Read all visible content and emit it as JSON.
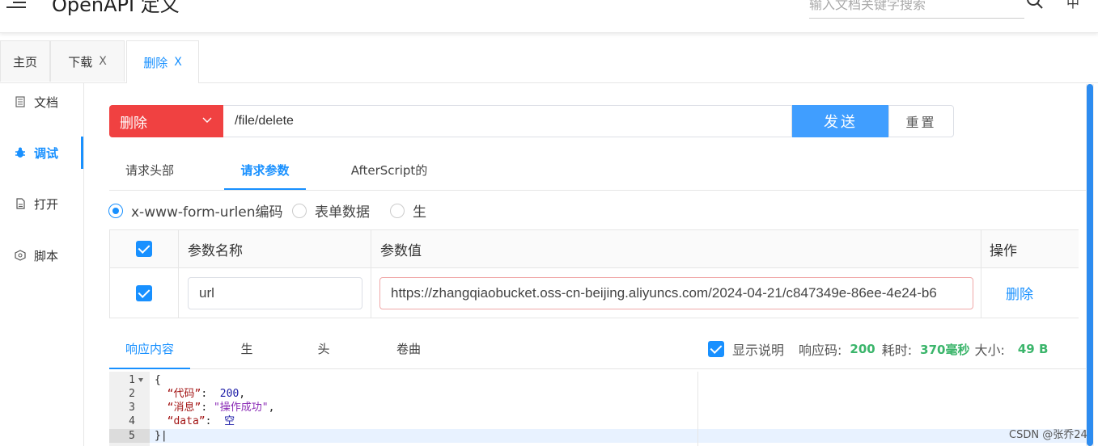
{
  "header": {
    "title": "OpenAPI 定义",
    "search_placeholder": "输入文档关键字搜索",
    "lang": "中"
  },
  "tabs": [
    {
      "label": "主页"
    },
    {
      "label": "下载",
      "close": "X"
    },
    {
      "label": "删除",
      "close": "X"
    }
  ],
  "sidebar": {
    "items": [
      {
        "label": "文档",
        "icon": "document-icon"
      },
      {
        "label": "调试",
        "icon": "bug-icon"
      },
      {
        "label": "打开",
        "icon": "file-icon"
      },
      {
        "label": "脚本",
        "icon": "script-icon"
      }
    ]
  },
  "request": {
    "method": "删除",
    "url": "/file/delete",
    "send_label": "发送",
    "reset_label": "重置"
  },
  "request_tabs": [
    "请求头部",
    "请求参数",
    "AfterScript的"
  ],
  "body_types": [
    "x-www-form-urlen编码",
    "表单数据",
    "生"
  ],
  "params": {
    "headers": {
      "name": "参数名称",
      "value": "参数值",
      "action": "操作"
    },
    "rows": [
      {
        "name": "url",
        "value": "https://zhangqiaobucket.oss-cn-beijing.aliyuncs.com/2024-04-21/c847349e-86ee-4e24-b6",
        "action": "删除"
      }
    ]
  },
  "response_tabs": [
    "响应内容",
    "生",
    "头",
    "卷曲"
  ],
  "response_meta": {
    "show_desc": "显示说明",
    "code_label": "响应码:",
    "code": "200",
    "time_label": "耗时:",
    "time": "370毫秒",
    "size_label": "大小:",
    "size": "49 B"
  },
  "code_lines": [
    "1",
    "2",
    "3",
    "4",
    "5"
  ],
  "code_text": {
    "l1": "{",
    "k2": "“代码”",
    "v2": "200",
    "k3": "“消息”",
    "v3": "\"操作成功\"",
    "k4": "“data”",
    "v4": "空",
    "l5": "}"
  },
  "watermark": "CSDN @张乔24",
  "colors": {
    "accent": "#1890ff",
    "method_bg": "#f04141",
    "send_bg": "#409eff",
    "success": "#3bb56b"
  }
}
